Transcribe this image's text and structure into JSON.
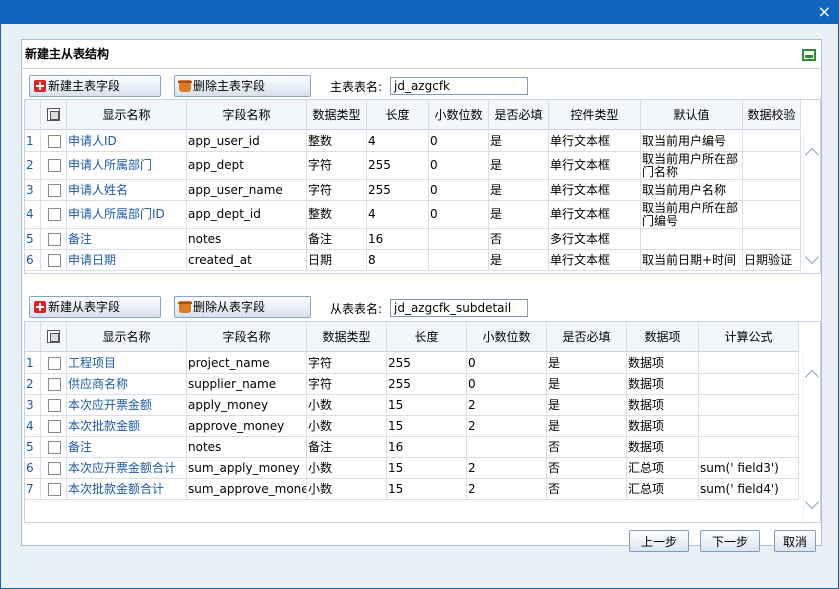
{
  "window": {
    "close_glyph": "×"
  },
  "panel": {
    "title": "新建主从表结构"
  },
  "master": {
    "add_label": "新建主表字段",
    "delete_label": "删除主表字段",
    "table_name_label": "主表表名:",
    "table_name_value": "jd_azgcfk",
    "columns": [
      "显示名称",
      "字段名称",
      "数据类型",
      "长度",
      "小数位数",
      "是否必填",
      "控件类型",
      "默认值",
      "数据校验"
    ],
    "rows": [
      {
        "n": "1",
        "name": "申请人ID",
        "field": "app_user_id",
        "type": "整数",
        "len": "4",
        "dec": "0",
        "req": "是",
        "ctl": "单行文本框",
        "def": "取当前用户编号",
        "val": ""
      },
      {
        "n": "2",
        "name": "申请人所属部门",
        "field": "app_dept",
        "type": "字符",
        "len": "255",
        "dec": "0",
        "req": "是",
        "ctl": "单行文本框",
        "def": "取当前用户所在部门名称",
        "val": ""
      },
      {
        "n": "3",
        "name": "申请人姓名",
        "field": "app_user_name",
        "type": "字符",
        "len": "255",
        "dec": "0",
        "req": "是",
        "ctl": "单行文本框",
        "def": "取当前用户名称",
        "val": ""
      },
      {
        "n": "4",
        "name": "申请人所属部门ID",
        "field": "app_dept_id",
        "type": "整数",
        "len": "4",
        "dec": "0",
        "req": "是",
        "ctl": "单行文本框",
        "def": "取当前用户所在部门编号",
        "val": ""
      },
      {
        "n": "5",
        "name": "备注",
        "field": "notes",
        "type": "备注",
        "len": "16",
        "dec": "",
        "req": "否",
        "ctl": "多行文本框",
        "def": "",
        "val": ""
      },
      {
        "n": "6",
        "name": "申请日期",
        "field": "created_at",
        "type": "日期",
        "len": "8",
        "dec": "",
        "req": "是",
        "ctl": "单行文本框",
        "def": "取当前日期+时间",
        "val": "日期验证"
      }
    ]
  },
  "detail": {
    "add_label": "新建从表字段",
    "delete_label": "删除从表字段",
    "table_name_label": "从表表名:",
    "table_name_value": "jd_azgcfk_subdetail",
    "columns": [
      "显示名称",
      "字段名称",
      "数据类型",
      "长度",
      "小数位数",
      "是否必填",
      "数据项",
      "计算公式"
    ],
    "rows": [
      {
        "n": "1",
        "name": "工程项目",
        "field": "project_name",
        "type": "字符",
        "len": "255",
        "dec": "0",
        "req": "是",
        "item": "数据项",
        "formula": ""
      },
      {
        "n": "2",
        "name": "供应商名称",
        "field": "supplier_name",
        "type": "字符",
        "len": "255",
        "dec": "0",
        "req": "是",
        "item": "数据项",
        "formula": ""
      },
      {
        "n": "3",
        "name": "本次应开票金额",
        "field": "apply_money",
        "type": "小数",
        "len": "15",
        "dec": "2",
        "req": "是",
        "item": "数据项",
        "formula": ""
      },
      {
        "n": "4",
        "name": "本次批款金额",
        "field": "approve_money",
        "type": "小数",
        "len": "15",
        "dec": "2",
        "req": "是",
        "item": "数据项",
        "formula": ""
      },
      {
        "n": "5",
        "name": "备注",
        "field": "notes",
        "type": "备注",
        "len": "16",
        "dec": "",
        "req": "否",
        "item": "数据项",
        "formula": ""
      },
      {
        "n": "6",
        "name": "本次应开票金额合计",
        "field": "sum_apply_money",
        "type": "小数",
        "len": "15",
        "dec": "2",
        "req": "否",
        "item": "汇总项",
        "formula": "sum(' field3')"
      },
      {
        "n": "7",
        "name": "本次批款金额合计",
        "field": "sum_approve_money",
        "type": "小数",
        "len": "15",
        "dec": "2",
        "req": "否",
        "item": "汇总项",
        "formula": "sum(' field4')"
      }
    ]
  },
  "footer": {
    "prev_label": "上一步",
    "next_label": "下一步",
    "cancel_label": "取消"
  }
}
